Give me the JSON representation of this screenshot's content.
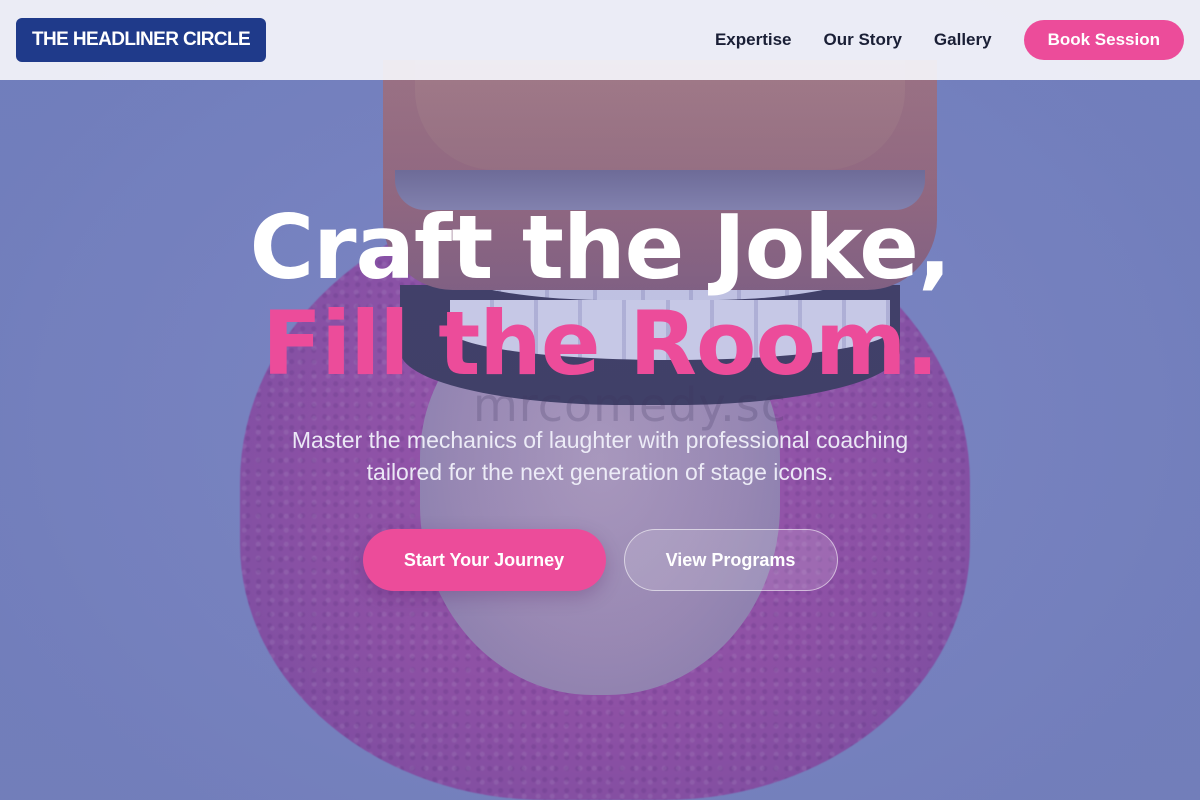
{
  "header": {
    "logo": "THE HEADLINER CIRCLE",
    "nav": [
      {
        "label": "Expertise"
      },
      {
        "label": "Our Story"
      },
      {
        "label": "Gallery"
      }
    ],
    "cta_label": "Book Session"
  },
  "hero": {
    "headline_line1": "Craft the Joke,",
    "headline_line2": "Fill the Room.",
    "subtitle": "Master the mechanics of laughter with professional coaching tailored for the next generation of stage icons.",
    "primary_cta": "Start Your Journey",
    "secondary_cta": "View Programs",
    "watermark": "mrcomedy.sc"
  },
  "colors": {
    "brand_navy": "#1f3a8a",
    "accent_pink": "#ec4c9a",
    "hero_overlay": "#7b86bd"
  }
}
